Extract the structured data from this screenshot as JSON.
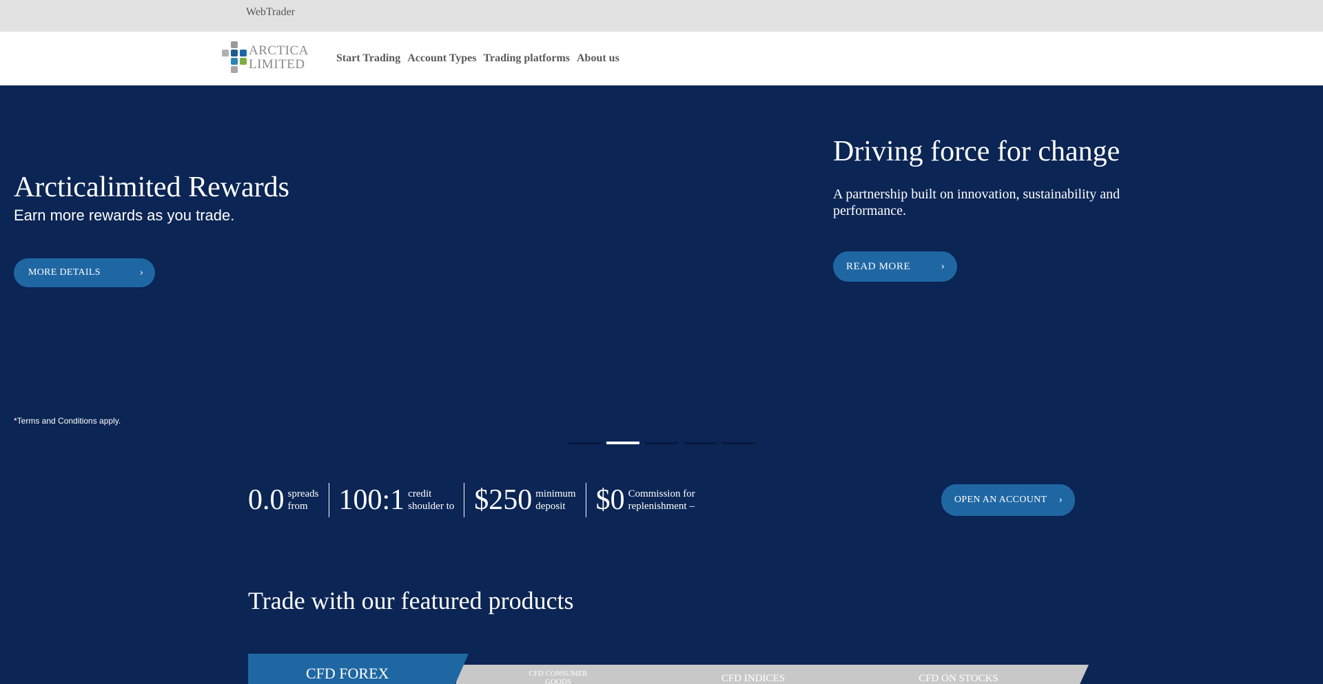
{
  "topbar": {
    "webtrader": "WebTrader"
  },
  "header": {
    "logo": {
      "line1": "ARCTICA",
      "line2": "LIMITED"
    },
    "nav": [
      "Start Trading",
      "Account Types",
      "Trading platforms",
      "About us"
    ]
  },
  "hero": {
    "left_slide": {
      "title": "Arcticalimited Rewards",
      "subtitle": "Earn more rewards as you trade.",
      "button": "MORE DETAILS",
      "terms": "*Terms and Conditions apply."
    },
    "right_slide": {
      "title": "Driving force for change",
      "text": "A partnership built on innovation, sustainability and performance.",
      "button": "READ MORE"
    },
    "slide_count": 5,
    "active_slide": 2
  },
  "stats": [
    {
      "value": "0.0",
      "label_line1": "spreads",
      "label_line2": "from"
    },
    {
      "value": "100:1",
      "label_line1": "credit",
      "label_line2": "shoulder to"
    },
    {
      "value": "$250",
      "label_line1": "minimum",
      "label_line2": "deposit"
    },
    {
      "value": "$0",
      "label_line1": "Commission for",
      "label_line2": "replenishment –"
    }
  ],
  "open_account_button": "OPEN AN ACCOUNT",
  "featured": {
    "title": "Trade with our featured products",
    "tabs": [
      "CFD FOREX",
      "CFD CONSUMER GOODS",
      "CFD INDICES",
      "CFD ON STOCKS"
    ],
    "active_tab": 0
  },
  "colors": {
    "hero_bg": "#0b2554",
    "button": "#1f67a3",
    "topbar_bg": "#e2e2e2",
    "tab_inactive": "#c8c8c8"
  },
  "icons": {
    "button_arrow": "arrow-right-icon"
  }
}
